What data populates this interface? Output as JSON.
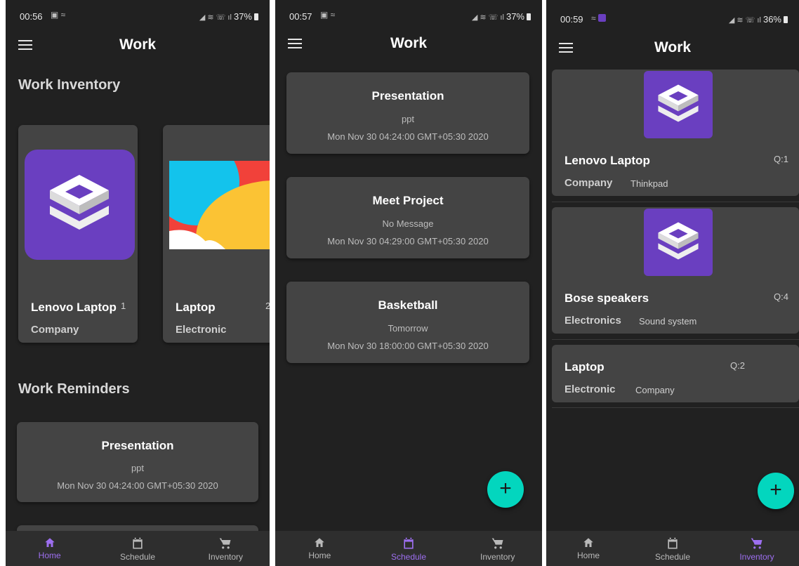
{
  "app": {
    "title": "Work"
  },
  "colors": {
    "background": "#212121",
    "card": "#444444",
    "accent": "#9d6ff0",
    "fab": "#03d6be",
    "item_image": "#6a3fc0"
  },
  "nav": {
    "home": "Home",
    "schedule": "Schedule",
    "inventory": "Inventory"
  },
  "screen1": {
    "status": {
      "time": "00:56",
      "battery": "37%"
    },
    "inventory_heading": "Work Inventory",
    "reminders_heading": "Work Reminders",
    "inventory": [
      {
        "name": "Lenovo Laptop",
        "qty": "1",
        "category": "Company"
      },
      {
        "name": "Laptop",
        "qty": "2",
        "category": "Electronic"
      }
    ],
    "reminder": {
      "title": "Presentation",
      "message": "ppt",
      "date": "Mon Nov 30 04:24:00 GMT+05:30 2020"
    }
  },
  "screen2": {
    "status": {
      "time": "00:57",
      "battery": "37%"
    },
    "reminders": [
      {
        "title": "Presentation",
        "message": "ppt",
        "date": "Mon Nov 30 04:24:00 GMT+05:30 2020"
      },
      {
        "title": "Meet Project",
        "message": "No Message",
        "date": "Mon Nov 30 04:29:00 GMT+05:30 2020"
      },
      {
        "title": "Basketball",
        "message": "Tomorrow",
        "date": "Mon Nov 30 18:00:00 GMT+05:30 2020"
      }
    ]
  },
  "screen3": {
    "status": {
      "time": "00:59",
      "battery": "36%"
    },
    "items": [
      {
        "name": "Lenovo Laptop",
        "qty": "Q:1",
        "category": "Company",
        "detail": "Thinkpad"
      },
      {
        "name": "Bose speakers",
        "qty": "Q:4",
        "category": "Electronics",
        "detail": "Sound system"
      },
      {
        "name": "Laptop",
        "qty": "Q:2",
        "category": "Electronic",
        "detail": "Company"
      }
    ]
  }
}
